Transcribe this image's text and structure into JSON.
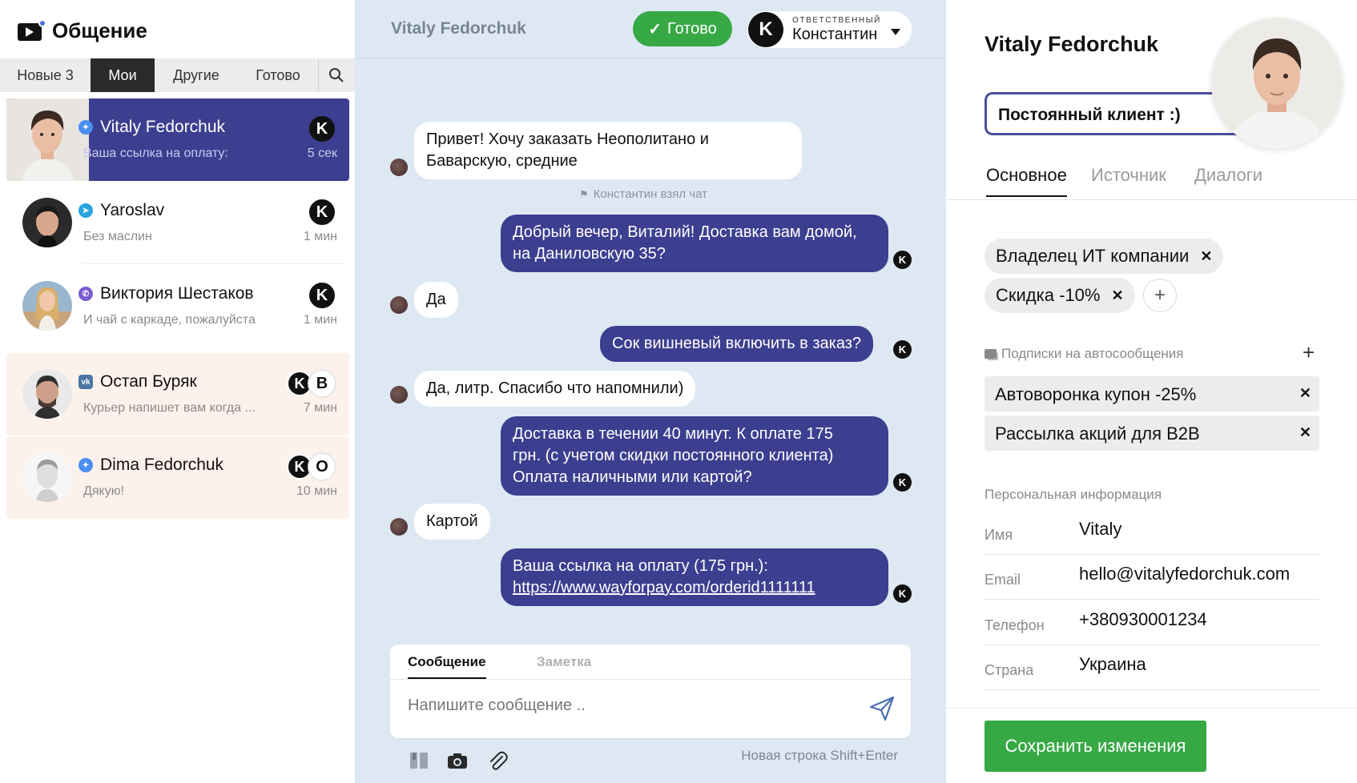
{
  "app": {
    "title": "Общение"
  },
  "tabs": [
    {
      "label": "Новые 3"
    },
    {
      "label": "Мои"
    },
    {
      "label": "Другие"
    },
    {
      "label": "Готово"
    }
  ],
  "chats": [
    {
      "name": "Vitaly Fedorchuk",
      "preview": "Ваша ссылка на оплату:",
      "time": "5 сек",
      "network": "messenger-icon",
      "badges": [
        "K"
      ]
    },
    {
      "name": "Yaroslav",
      "preview": "Без маслин",
      "time": "1 мин",
      "network": "telegram-icon",
      "badges": [
        "K"
      ]
    },
    {
      "name": "Виктория Шестаков",
      "preview": "И чай с каркаде, пожалуйста",
      "time": "1 мин",
      "network": "viber-icon",
      "badges": [
        "K"
      ]
    },
    {
      "name": "Остап Буряк",
      "preview": "Курьер напишет вам когда ...",
      "time": "7 мин",
      "network": "vk-icon",
      "badges": [
        "K",
        "B"
      ]
    },
    {
      "name": "Dima Fedorchuk",
      "preview": "Дякую!",
      "time": "10 мин",
      "network": "messenger-icon",
      "badges": [
        "K",
        "O"
      ]
    }
  ],
  "conversation": {
    "title": "Vitaly Fedorchuk",
    "done_label": "Готово",
    "responsible_label": "ОТВЕТСТВЕННЫЙ",
    "responsible_name": "Константин",
    "responsible_initial": "K",
    "system_note": "Константин взял чат",
    "messages": [
      {
        "dir": "in",
        "lines": [
          "Привет! Хочу заказать Неополитано и",
          "Баварскую, средние"
        ]
      },
      {
        "dir": "out",
        "lines": [
          "Добрый вечер, Виталий! Доставка вам домой,",
          "на Даниловскую 35?"
        ]
      },
      {
        "dir": "in",
        "lines": [
          "Да"
        ]
      },
      {
        "dir": "out",
        "lines": [
          "Сок вишневый включить в заказ?"
        ]
      },
      {
        "dir": "in",
        "lines": [
          "Да, литр. Спасибо что напомнили)"
        ]
      },
      {
        "dir": "out",
        "lines": [
          "Доставка в течении 40 минут. К оплате 175",
          "грн. (с учетом скидки постоянного клиента)",
          "Оплата наличными или картой?"
        ]
      },
      {
        "dir": "in",
        "lines": [
          "Картой"
        ]
      },
      {
        "dir": "out",
        "lines": [
          "Ваша ссылка на оплату (175 грн.):"
        ],
        "link": "https://www.wayforpay.com/orderid1111111"
      }
    ],
    "composer": {
      "tab_message": "Сообщение",
      "tab_note": "Заметка",
      "placeholder": "Напишите сообщение ..",
      "hint": "Новая строка Shift+Enter"
    }
  },
  "profile": {
    "name": "Vitaly Fedorchuk",
    "status": "Постоянный клиент :)",
    "tabs": [
      "Основное",
      "Источник",
      "Диалоги"
    ],
    "tags": [
      "Владелец ИТ компании",
      "Скидка -10%"
    ],
    "subscriptions_title": "Подписки на автосообщения",
    "subscriptions": [
      "Автоворонка купон -25%",
      "Рассылка акций для B2B"
    ],
    "personal_title": "Персональная информация",
    "fields": [
      {
        "label": "Имя",
        "value": "Vitaly"
      },
      {
        "label": "Email",
        "value": "hello@vitalyfedorchuk.com"
      },
      {
        "label": "Телефон",
        "value": "+380930001234"
      },
      {
        "label": "Страна",
        "value": "Украина"
      }
    ],
    "save_label": "Сохранить изменения"
  },
  "colors": {
    "accent": "#3c3f8f",
    "success": "#36a844",
    "chat_bg": "#dde8f3"
  }
}
